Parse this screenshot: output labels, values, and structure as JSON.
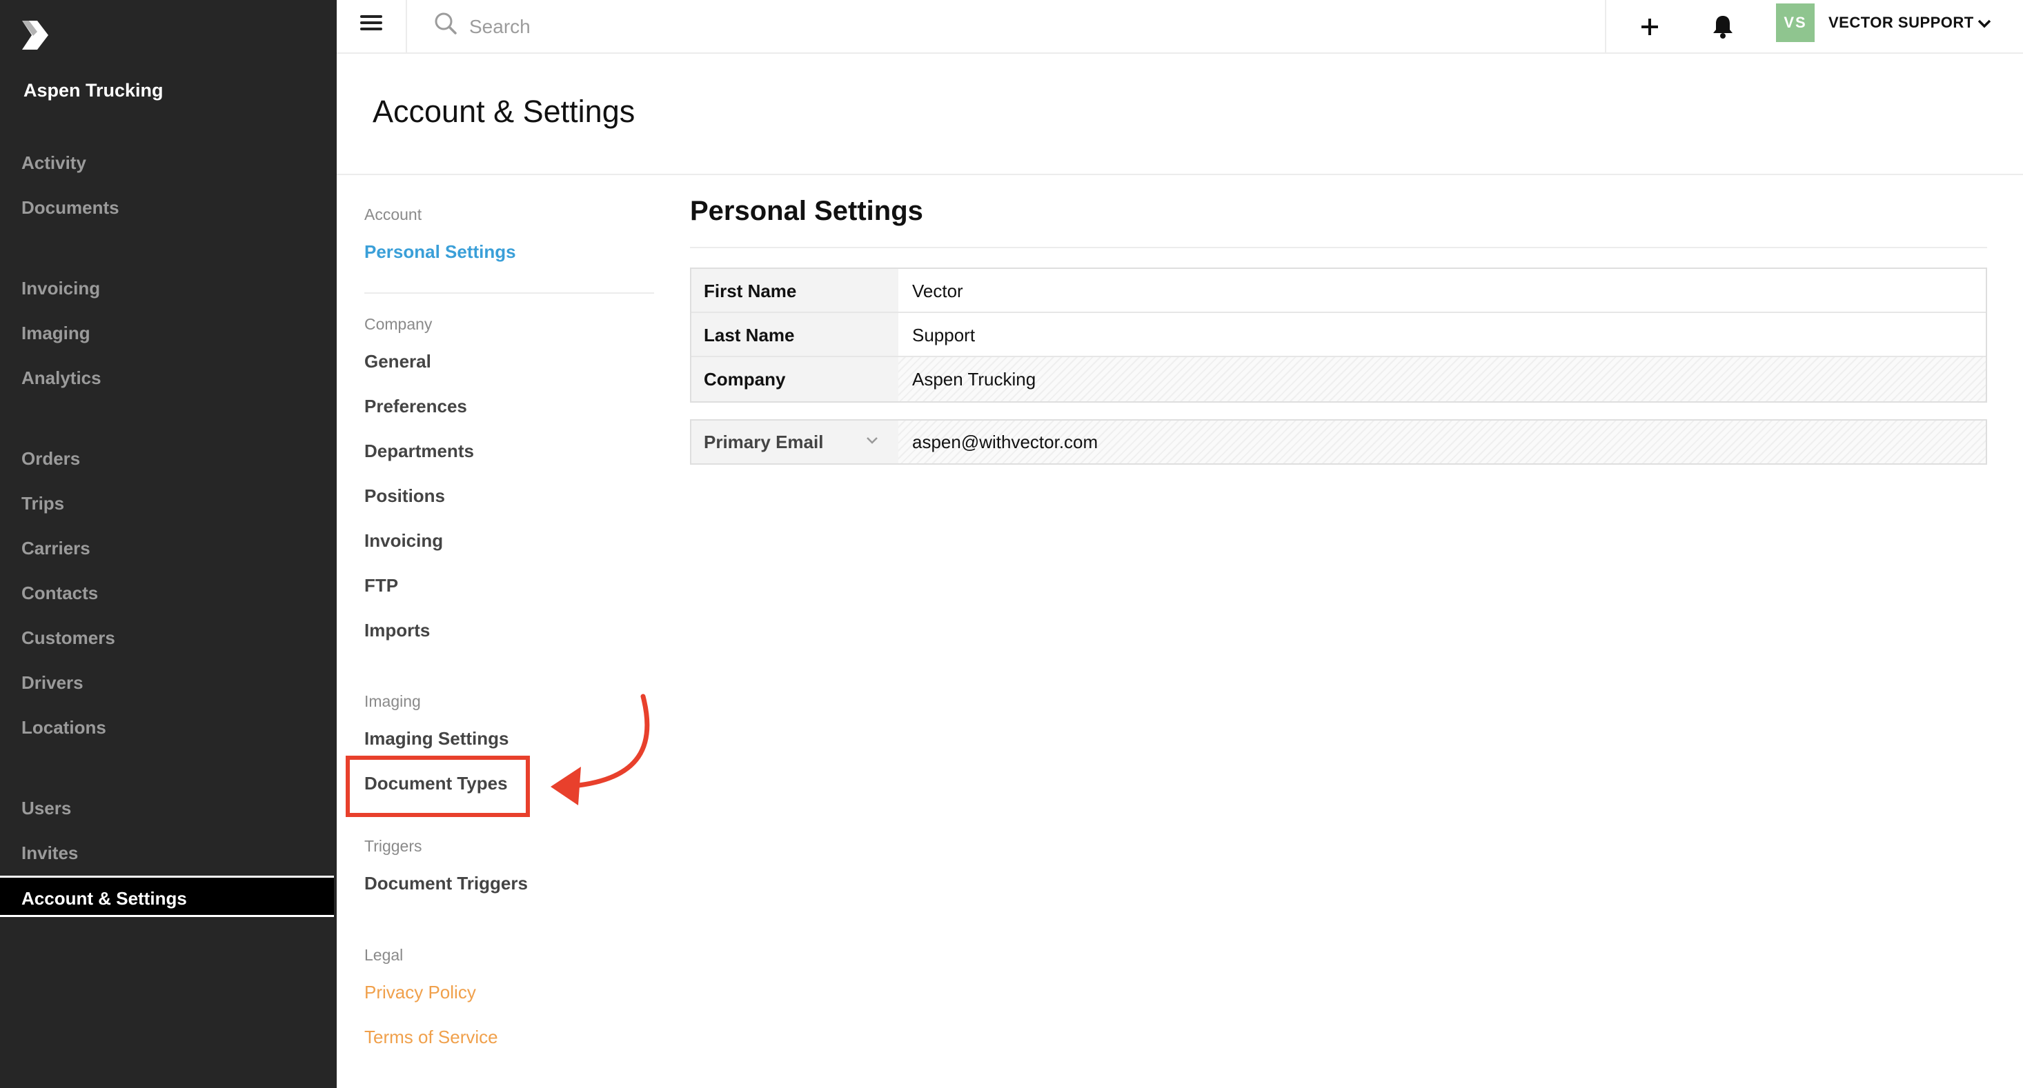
{
  "sidebar": {
    "logo_icon": "vector-logo-icon",
    "company": "Aspen Trucking",
    "items": [
      {
        "label": "Activity"
      },
      {
        "label": "Documents"
      },
      {
        "label": "Invoicing"
      },
      {
        "label": "Imaging"
      },
      {
        "label": "Analytics"
      },
      {
        "label": "Orders"
      },
      {
        "label": "Trips"
      },
      {
        "label": "Carriers"
      },
      {
        "label": "Contacts"
      },
      {
        "label": "Customers"
      },
      {
        "label": "Drivers"
      },
      {
        "label": "Locations"
      },
      {
        "label": "Users"
      },
      {
        "label": "Invites"
      },
      {
        "label": "Account & Settings",
        "active": true
      }
    ]
  },
  "topbar": {
    "menu_icon": "hamburger-menu-icon",
    "search_icon": "search-icon",
    "search_placeholder": "Search",
    "add_icon": "plus-icon",
    "notifications_icon": "bell-icon",
    "avatar_initials": "VS",
    "avatar_color": "#8fc58f",
    "user_name": "VECTOR SUPPORT",
    "user_menu_icon": "chevron-down-icon"
  },
  "page": {
    "title": "Account & Settings"
  },
  "settings_menu": {
    "account_heading": "Account",
    "personal_settings": "Personal Settings",
    "company_heading": "Company",
    "company_items": [
      "General",
      "Preferences",
      "Departments",
      "Positions",
      "Invoicing",
      "FTP",
      "Imports"
    ],
    "imaging_heading": "Imaging",
    "imaging_items": [
      "Imaging Settings",
      "Document Types"
    ],
    "triggers_heading": "Triggers",
    "triggers_items": [
      "Document Triggers"
    ],
    "legal_heading": "Legal",
    "legal_items": [
      "Privacy Policy",
      "Terms of Service"
    ]
  },
  "personal_settings": {
    "title": "Personal Settings",
    "fields": [
      {
        "label": "First Name",
        "value": "Vector"
      },
      {
        "label": "Last Name",
        "value": "Support"
      },
      {
        "label": "Company",
        "value": "Aspen Trucking"
      }
    ],
    "email": {
      "label": "Primary Email",
      "value": "aspen@withvector.com"
    }
  },
  "annotation": {
    "highlight_color": "#e8402c"
  },
  "colors": {
    "sidebar_bg": "#262626",
    "accent_blue": "#3a9fd8",
    "legal_orange": "#f0a04b"
  }
}
